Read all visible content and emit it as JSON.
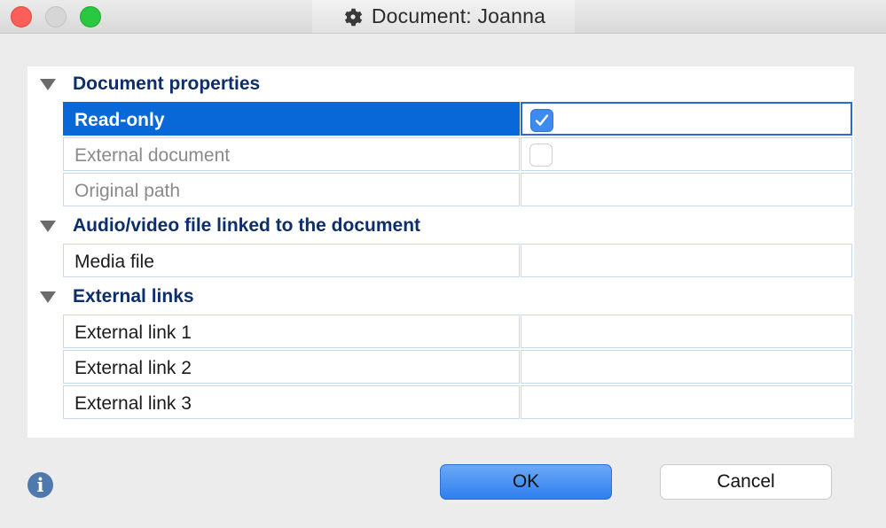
{
  "window": {
    "title": "Document:  Joanna",
    "title_icon": "gear-icon"
  },
  "sections": [
    {
      "label": "Document properties",
      "rows": [
        {
          "label": "Read-only",
          "checkbox": true,
          "checked": true,
          "selected": true
        },
        {
          "label": "External document",
          "checkbox": true,
          "checked": false,
          "disabled": true
        },
        {
          "label": "Original path",
          "disabled": true
        }
      ]
    },
    {
      "label": "Audio/video file linked to the document",
      "rows": [
        {
          "label": "Media file"
        }
      ]
    },
    {
      "label": "External links",
      "rows": [
        {
          "label": "External link 1"
        },
        {
          "label": "External link 2"
        },
        {
          "label": "External link 3"
        }
      ]
    }
  ],
  "footer": {
    "info_glyph": "i",
    "ok_label": "OK",
    "cancel_label": "Cancel"
  },
  "colors": {
    "selection": "#0868d8",
    "section_text": "#0c2f6b",
    "ok_button": "#2f7ff0"
  }
}
